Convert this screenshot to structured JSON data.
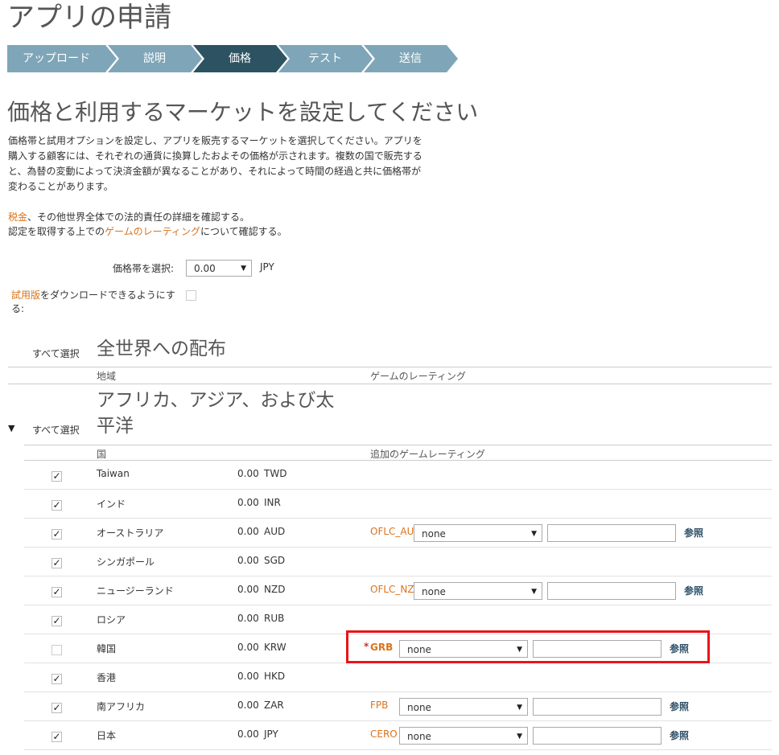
{
  "page": {
    "title": "アプリの申請"
  },
  "steps": [
    {
      "label": "アップロード",
      "active": false
    },
    {
      "label": "説明",
      "active": false
    },
    {
      "label": "価格",
      "active": true
    },
    {
      "label": "テスト",
      "active": false
    },
    {
      "label": "送信",
      "active": false
    }
  ],
  "colors": {
    "step_inactive": "#7fa6b8",
    "step_active": "#2d5363",
    "link": "#d9731c",
    "highlight": "#e8141c"
  },
  "section": {
    "title": "価格と利用するマーケットを設定してください",
    "desc": [
      "価格帯と試用オプションを設定し、アプリを販売するマーケットを選択してください。アプリを",
      "購入する顧客には、それぞれの通貨に換算したおよその価格が示されます。複数の国で販売する",
      "と、為替の変動によって決済金額が異なることがあり、それによって時間の経過と共に価格帯が",
      "変わることがあります。"
    ],
    "tax_link": "税金",
    "tax_text": "、その他世界全体での法的責任の詳細を確認する。",
    "rating_pre": "認定を取得する上での",
    "rating_link": "ゲームのレーティング",
    "rating_post": "について確認する。"
  },
  "price": {
    "label": "価格帯を選択:",
    "value": "0.00",
    "currency": "JPY"
  },
  "trial": {
    "link": "試用版",
    "text1": "をダウンロードできるようにす",
    "text2": "る:"
  },
  "worldwide": {
    "select_all": "すべて選択",
    "title": "全世界への配布",
    "col_region": "地域",
    "col_rating": "ゲームのレーティング"
  },
  "region": {
    "select_all": "すべて選択",
    "title1": "アフリカ、アジア、および太",
    "title2": "平洋",
    "col_country": "国",
    "col_rating": "追加のゲームレーティング"
  },
  "browse_label": "参照",
  "countries": [
    {
      "name": "Taiwan",
      "price": "0.00",
      "cur": "TWD",
      "checked": true
    },
    {
      "name": "インド",
      "price": "0.00",
      "cur": "INR",
      "checked": true
    },
    {
      "name": "オーストラリア",
      "price": "0.00",
      "cur": "AUD",
      "checked": true,
      "rating": "OFLC_AU",
      "required": false,
      "option": "none"
    },
    {
      "name": "シンガポール",
      "price": "0.00",
      "cur": "SGD",
      "checked": true
    },
    {
      "name": "ニュージーランド",
      "price": "0.00",
      "cur": "NZD",
      "checked": true,
      "rating": "OFLC_NZ",
      "required": false,
      "option": "none"
    },
    {
      "name": "ロシア",
      "price": "0.00",
      "cur": "RUB",
      "checked": true
    },
    {
      "name": "韓国",
      "price": "0.00",
      "cur": "KRW",
      "checked": false,
      "rating": "GRB",
      "required": true,
      "option": "none"
    },
    {
      "name": "香港",
      "price": "0.00",
      "cur": "HKD",
      "checked": true
    },
    {
      "name": "南アフリカ",
      "price": "0.00",
      "cur": "ZAR",
      "checked": true,
      "rating": "FPB",
      "required": false,
      "option": "none"
    },
    {
      "name": "日本",
      "price": "0.00",
      "cur": "JPY",
      "checked": true,
      "rating": "CERO",
      "required": false,
      "option": "none"
    }
  ]
}
